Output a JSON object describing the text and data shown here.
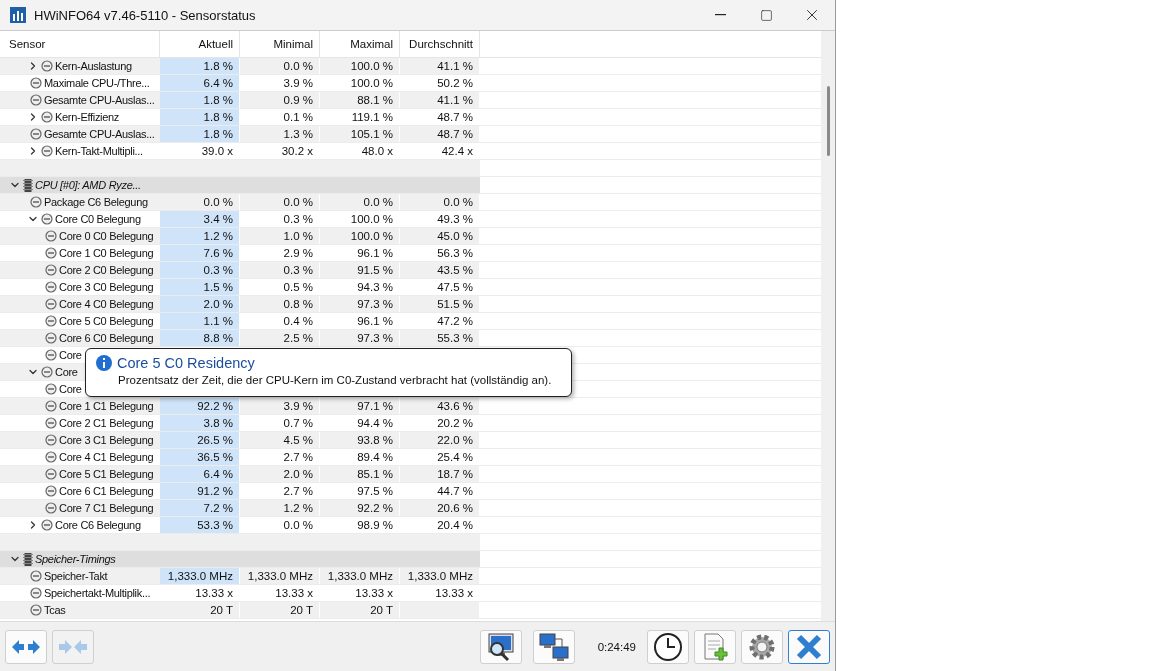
{
  "window": {
    "title": "HWiNFO64 v7.46-5110 - Sensorstatus"
  },
  "table": {
    "columns": [
      "Sensor",
      "Aktuell",
      "Minimal",
      "Maximal",
      "Durchschnitt"
    ],
    "sections": [
      {
        "rows": [
          {
            "label": "Kern-Auslastung",
            "values": [
              "1.8 %",
              "0.0 %",
              "100.0 %",
              "41.1 %"
            ],
            "highlighted": true,
            "expanded": false
          },
          {
            "label": "Maximale CPU-/Thre...",
            "values": [
              "6.4 %",
              "3.9 %",
              "100.0 %",
              "50.2 %"
            ],
            "highlighted": true
          },
          {
            "label": "Gesamte CPU-Auslas...",
            "values": [
              "1.8 %",
              "0.9 %",
              "88.1 %",
              "41.1 %"
            ],
            "highlighted": true
          },
          {
            "label": "Kern-Effizienz",
            "values": [
              "1.8 %",
              "0.1 %",
              "119.1 %",
              "48.7 %"
            ],
            "highlighted": true,
            "expanded": false
          },
          {
            "label": "Gesamte CPU-Auslas...",
            "values": [
              "1.8 %",
              "1.3 %",
              "105.1 %",
              "48.7 %"
            ],
            "highlighted": true
          },
          {
            "label": "Kern-Takt-Multipli...",
            "values": [
              "39.0 x",
              "30.2 x",
              "48.0 x",
              "42.4 x"
            ],
            "highlighted": false,
            "expanded": false
          }
        ]
      },
      {
        "title": "CPU [#0]: AMD Ryze...",
        "expanded": true,
        "rows": [
          {
            "label": "Package C6 Belegung",
            "values": [
              "0.0 %",
              "0.0 %",
              "0.0 %",
              "0.0 %"
            ],
            "highlighted": false
          },
          {
            "label": "Core C0 Belegung",
            "values": [
              "3.4 %",
              "0.3 %",
              "100.0 %",
              "49.3 %"
            ],
            "highlighted": true,
            "expanded": true,
            "children": [
              {
                "label": "Core 0 C0 Belegung",
                "values": [
                  "1.2 %",
                  "1.0 %",
                  "100.0 %",
                  "45.0 %"
                ],
                "highlighted": true
              },
              {
                "label": "Core 1 C0 Belegung",
                "values": [
                  "7.6 %",
                  "2.9 %",
                  "96.1 %",
                  "56.3 %"
                ],
                "highlighted": true
              },
              {
                "label": "Core 2 C0 Belegung",
                "values": [
                  "0.3 %",
                  "0.3 %",
                  "91.5 %",
                  "43.5 %"
                ],
                "highlighted": true
              },
              {
                "label": "Core 3 C0 Belegung",
                "values": [
                  "1.5 %",
                  "0.5 %",
                  "94.3 %",
                  "47.5 %"
                ],
                "highlighted": true
              },
              {
                "label": "Core 4 C0 Belegung",
                "values": [
                  "2.0 %",
                  "0.8 %",
                  "97.3 %",
                  "51.5 %"
                ],
                "highlighted": true
              },
              {
                "label": "Core 5 C0 Belegung",
                "values": [
                  "1.1 %",
                  "0.4 %",
                  "96.1 %",
                  "47.2 %"
                ],
                "highlighted": true
              },
              {
                "label": "Core 6 C0 Belegung",
                "values": [
                  "8.8 %",
                  "2.5 %",
                  "97.3 %",
                  "55.3 %"
                ],
                "highlighted": true
              },
              {
                "label": "Core"
              }
            ]
          },
          {
            "label": "Core",
            "expanded": true,
            "children": [
              {
                "label": "Core"
              },
              {
                "label": "Core 1 C1 Belegung",
                "values": [
                  "92.2 %",
                  "3.9 %",
                  "97.1 %",
                  "43.6 %"
                ],
                "highlighted": true
              },
              {
                "label": "Core 2 C1 Belegung",
                "values": [
                  "3.8 %",
                  "0.7 %",
                  "94.4 %",
                  "20.2 %"
                ],
                "highlighted": true
              },
              {
                "label": "Core 3 C1 Belegung",
                "values": [
                  "26.5 %",
                  "4.5 %",
                  "93.8 %",
                  "22.0 %"
                ],
                "highlighted": true
              },
              {
                "label": "Core 4 C1 Belegung",
                "values": [
                  "36.5 %",
                  "2.7 %",
                  "89.4 %",
                  "25.4 %"
                ],
                "highlighted": true
              },
              {
                "label": "Core 5 C1 Belegung",
                "values": [
                  "6.4 %",
                  "2.0 %",
                  "85.1 %",
                  "18.7 %"
                ],
                "highlighted": true
              },
              {
                "label": "Core 6 C1 Belegung",
                "values": [
                  "91.2 %",
                  "2.7 %",
                  "97.5 %",
                  "44.7 %"
                ],
                "highlighted": true
              },
              {
                "label": "Core 7 C1 Belegung",
                "values": [
                  "7.2 %",
                  "1.2 %",
                  "92.2 %",
                  "20.6 %"
                ],
                "highlighted": true
              }
            ]
          },
          {
            "label": "Core C6 Belegung",
            "values": [
              "53.3 %",
              "0.0 %",
              "98.9 %",
              "20.4 %"
            ],
            "highlighted": true,
            "expanded": false
          }
        ]
      },
      {
        "title": "Speicher-Timings",
        "expanded": true,
        "rows": [
          {
            "label": "Speicher-Takt",
            "values": [
              "1,333.0 MHz",
              "1,333.0 MHz",
              "1,333.0 MHz",
              "1,333.0 MHz"
            ],
            "highlighted": true
          },
          {
            "label": "Speichertakt-Multiplik...",
            "values": [
              "13.33 x",
              "13.33 x",
              "13.33 x",
              "13.33 x"
            ],
            "highlighted": false
          },
          {
            "label": "Tcas",
            "values": [
              "20 T",
              "20 T",
              "20 T"
            ],
            "highlighted": false
          }
        ]
      }
    ]
  },
  "tooltip": {
    "title": "Core 5 C0 Residency",
    "text": "Prozentsatz der Zeit, die der CPU-Kern im C0-Zustand verbracht hat (vollständig an)."
  },
  "toolbar": {
    "left": [
      {
        "kind": "expand",
        "disabled": false
      },
      {
        "kind": "collapse",
        "disabled": true
      }
    ],
    "right": [
      {
        "kind": "monitor",
        "focused": false
      },
      {
        "kind": "network",
        "focused": false
      }
    ],
    "time": "0:24:49",
    "right2": [
      {
        "kind": "clock",
        "focused": false
      },
      {
        "kind": "report",
        "focused": false
      },
      {
        "kind": "settings",
        "focused": false
      },
      {
        "kind": "close",
        "focused": true
      }
    ]
  }
}
